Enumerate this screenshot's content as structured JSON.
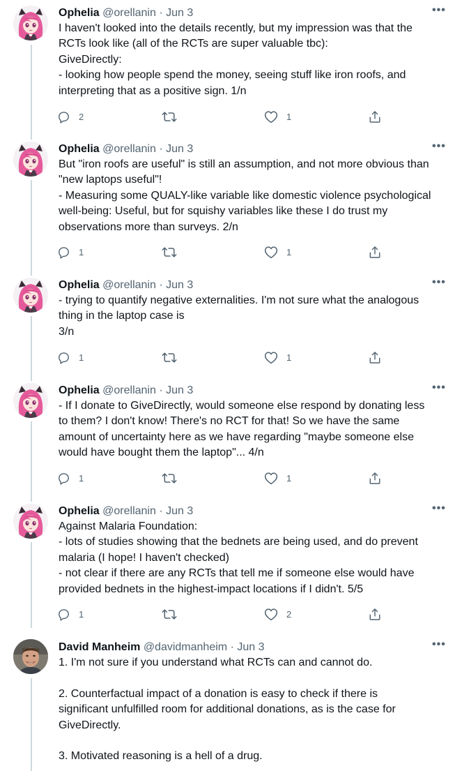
{
  "tweets": [
    {
      "name": "Ophelia",
      "handle": "@orellanin",
      "separator": "·",
      "date": "Jun 3",
      "lines": [
        "I haven't looked into the details recently, but my impression was that the",
        "RCTs look like (all of the RCTs are super valuable tbc):",
        "GiveDirectly:",
        "- looking how people spend the money, seeing stuff like iron roofs, and",
        "interpreting that as a positive sign. 1/n"
      ],
      "replies": "2",
      "retweets": "",
      "likes": "1"
    },
    {
      "name": "Ophelia",
      "handle": "@orellanin",
      "separator": "·",
      "date": "Jun 3",
      "lines": [
        "But \"iron roofs are useful\" is still an assumption, and not more obvious than",
        "\"new laptops useful\"!",
        "- Measuring some QUALY-like variable like domestic violence psychological",
        "well-being: Useful, but for squishy variables like these I do trust my",
        "observations more than surveys. 2/n"
      ],
      "replies": "1",
      "retweets": "",
      "likes": "1"
    },
    {
      "name": "Ophelia",
      "handle": "@orellanin",
      "separator": "·",
      "date": "Jun 3",
      "lines": [
        "- trying to quantify negative externalities. I'm not sure what the analogous",
        "thing in the laptop case is",
        "3/n"
      ],
      "replies": "1",
      "retweets": "",
      "likes": "1"
    },
    {
      "name": "Ophelia",
      "handle": "@orellanin",
      "separator": "·",
      "date": "Jun 3",
      "lines": [
        "- If I donate to GiveDirectly, would someone else respond by donating less",
        "to them? I don't know! There's no RCT for that! So we have the same",
        "amount of uncertainty here as we have regarding \"maybe someone else",
        "would have bought them the laptop\"... 4/n"
      ],
      "replies": "1",
      "retweets": "",
      "likes": "1"
    },
    {
      "name": "Ophelia",
      "handle": "@orellanin",
      "separator": "·",
      "date": "Jun 3",
      "lines": [
        "Against Malaria Foundation:",
        "- lots of studies showing that the bednets are being used, and do prevent",
        "malaria (I hope! I haven't checked)",
        "- not clear if there are any RCTs that tell me if someone else would have",
        "provided bednets in the highest-impact locations if I didn't. 5/5"
      ],
      "replies": "1",
      "retweets": "",
      "likes": "2"
    },
    {
      "name": "David Manheim",
      "handle": "@davidmanheim",
      "separator": "·",
      "date": "Jun 3",
      "lines": [
        "1. I'm not sure if you understand what RCTs can and cannot do.",
        "",
        "2. Counterfactual impact of a donation is easy to check if there is",
        "significant unfulfilled room for additional donations, as is the case for",
        "GiveDirectly.",
        "",
        "3. Motivated reasoning is a hell of a drug."
      ]
    }
  ],
  "more_glyph": "•••",
  "icons": {
    "reply": "reply-icon",
    "retweet": "retweet-icon",
    "like": "like-icon",
    "share": "share-icon",
    "more": "more-icon"
  },
  "colors": {
    "text": "#0f1419",
    "secondary": "#536471",
    "thread_line": "#cfd9de",
    "ophelia_hair": "#e55a9b",
    "david_skin": "#c89a80"
  }
}
